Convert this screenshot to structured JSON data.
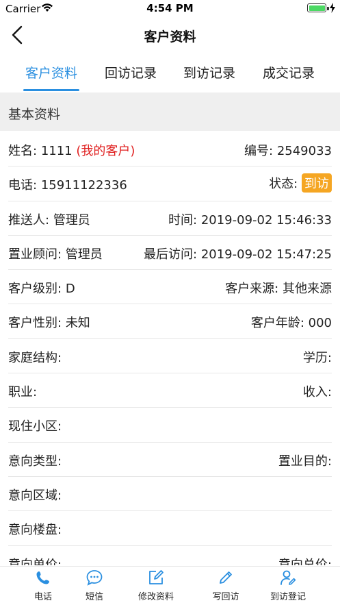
{
  "status_bar": {
    "carrier": "Carrier",
    "time": "4:54 PM"
  },
  "nav": {
    "title": "客户资料"
  },
  "tabs": [
    {
      "label": "客户资料",
      "active": true
    },
    {
      "label": "回访记录",
      "active": false
    },
    {
      "label": "到访记录",
      "active": false
    },
    {
      "label": "成交记录",
      "active": false
    }
  ],
  "section": {
    "title": "基本资料"
  },
  "rows": {
    "name": {
      "label": "姓名:",
      "value": "1111",
      "tag": "(我的客户)"
    },
    "number": {
      "label": "编号:",
      "value": "2549033"
    },
    "phone": {
      "label": "电话:",
      "value": "15911122336"
    },
    "status": {
      "label": "状态:",
      "value": "到访"
    },
    "referrer": {
      "label": "推送人:",
      "value": "管理员"
    },
    "time": {
      "label": "时间:",
      "value": "2019-09-02 15:46:33"
    },
    "consultant": {
      "label": "置业顾问:",
      "value": "管理员"
    },
    "last_visit": {
      "label": "最后访问:",
      "value": "2019-09-02 15:47:25"
    },
    "level": {
      "label": "客户级别:",
      "value": "D"
    },
    "source": {
      "label": "客户来源:",
      "value": "其他来源"
    },
    "gender": {
      "label": "客户性别:",
      "value": "未知"
    },
    "age": {
      "label": "客户年龄:",
      "value": "000"
    },
    "family": {
      "label": "家庭结构:",
      "value": ""
    },
    "education": {
      "label": "学历:",
      "value": ""
    },
    "job": {
      "label": "职业:",
      "value": ""
    },
    "income": {
      "label": "收入:",
      "value": ""
    },
    "community": {
      "label": "现住小区:",
      "value": ""
    },
    "intent_type": {
      "label": "意向类型:",
      "value": ""
    },
    "purpose": {
      "label": "置业目的:",
      "value": ""
    },
    "intent_area": {
      "label": "意向区域:",
      "value": ""
    },
    "intent_building": {
      "label": "意向楼盘:",
      "value": ""
    },
    "unit_price": {
      "label": "意向单价:",
      "value": ""
    },
    "total_price": {
      "label": "意向总价:",
      "value": ""
    }
  },
  "bottom_bar": {
    "items": [
      {
        "label": "电话",
        "icon": "phone-icon"
      },
      {
        "label": "短信",
        "icon": "message-icon"
      },
      {
        "label": "修改资料",
        "icon": "edit-icon"
      },
      {
        "label": "写回访",
        "icon": "pen-icon"
      },
      {
        "label": "到访登记",
        "icon": "user-edit-icon"
      }
    ]
  },
  "colors": {
    "accent": "#2a8fe0",
    "badge": "#f5a623",
    "tag_red": "#e02020",
    "section_bg": "#efefef"
  }
}
